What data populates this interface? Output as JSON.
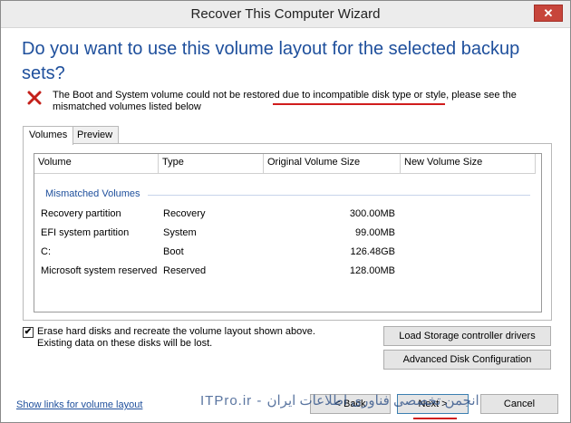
{
  "window": {
    "title": "Recover This Computer Wizard",
    "close_glyph": "✕"
  },
  "heading": "Do you want to use this volume layout for the selected backup sets?",
  "error": {
    "icon": "error-x-icon",
    "message_part1": "The Boot and System volume could not be restored ",
    "message_part2": "due to incompatible disk type or style",
    "message_part3": ", please see the mismatched volumes listed below"
  },
  "tabs": [
    {
      "label": "Volumes",
      "active": true
    },
    {
      "label": "Preview",
      "active": false
    }
  ],
  "table": {
    "columns": [
      "Volume",
      "Type",
      "Original Volume Size",
      "New Volume Size"
    ],
    "group_label": "Mismatched Volumes",
    "rows": [
      {
        "volume": "Recovery partition",
        "type": "Recovery",
        "original": "300.00MB",
        "new": ""
      },
      {
        "volume": "EFI system partition",
        "type": "System",
        "original": "99.00MB",
        "new": ""
      },
      {
        "volume": "C:",
        "type": "Boot",
        "original": "126.48GB",
        "new": ""
      },
      {
        "volume": "Microsoft system reserved",
        "type": "Reserved",
        "original": "128.00MB",
        "new": ""
      }
    ]
  },
  "erase_option": {
    "checked": true,
    "check_glyph": "✔",
    "line1": "Erase hard disks and recreate the volume layout shown above.",
    "line2": "Existing data on these disks will be lost."
  },
  "buttons": {
    "load_drivers": "Load Storage controller drivers",
    "advanced_disk": "Advanced Disk Configuration",
    "back": "< Back",
    "next": "Next >",
    "cancel": "Cancel"
  },
  "link_text": "Show links for volume layout",
  "watermark": "ITPro.ir - انجمن تخصصی فناوری اطلاعات ایران",
  "colors": {
    "heading_blue": "#1e4f9c",
    "error_red": "#c4201a",
    "underline_red": "#d01c1c"
  }
}
